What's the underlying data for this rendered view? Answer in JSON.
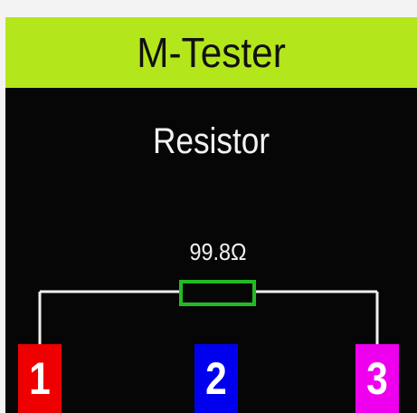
{
  "app": {
    "title": "M-Tester"
  },
  "measurement": {
    "component": "Resistor",
    "value": "99.8Ω"
  },
  "pins": [
    {
      "label": "1",
      "color": "#ee0000"
    },
    {
      "label": "2",
      "color": "#0000ee"
    },
    {
      "label": "3",
      "color": "#ee00ee"
    }
  ],
  "colors": {
    "title_bar": "#b4e61c",
    "screen_background": "#060606",
    "resistor_outline": "#22bb22",
    "wire": "#f0f0f0"
  }
}
